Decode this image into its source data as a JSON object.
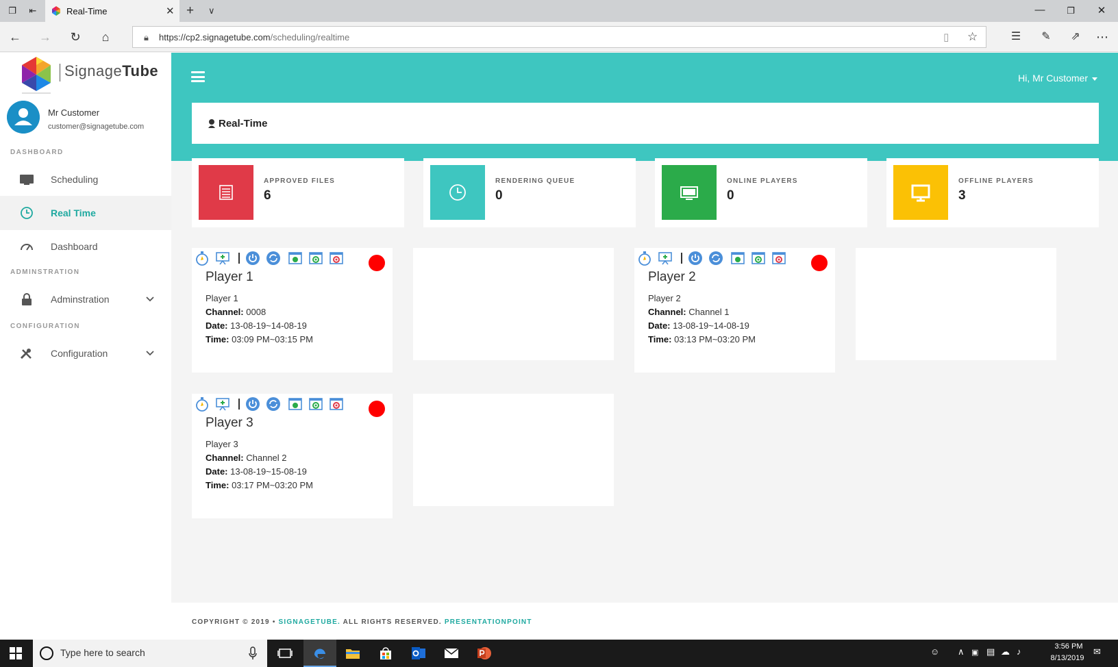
{
  "browser": {
    "tab_title": "Real-Time",
    "url_host": "https://cp2.signagetube.com",
    "url_path": "/scheduling/realtime"
  },
  "brand": {
    "light": "Signage",
    "bold": "Tube"
  },
  "user": {
    "name": "Mr Customer",
    "email": "customer@signagetube.com",
    "greeting": "Hi, Mr Customer"
  },
  "sidebar": {
    "sections": [
      "DASHBOARD",
      "ADMINSTRATION",
      "CONFIGURATION"
    ],
    "items": [
      {
        "label": "Scheduling",
        "icon": "monitor-icon"
      },
      {
        "label": "Real Time",
        "icon": "clock-icon",
        "active": true
      },
      {
        "label": "Dashboard",
        "icon": "gauge-icon"
      },
      {
        "label": "Adminstration",
        "icon": "lock-icon"
      },
      {
        "label": "Configuration",
        "icon": "tools-icon"
      }
    ]
  },
  "page": {
    "title": "Real-Time"
  },
  "stats": [
    {
      "label": "APPROVED FILES",
      "value": "6",
      "color": "#e03a48",
      "icon": "list-icon"
    },
    {
      "label": "RENDERING QUEUE",
      "value": "0",
      "color": "#3ec6c0",
      "icon": "clock-icon"
    },
    {
      "label": "ONLINE PLAYERS",
      "value": "0",
      "color": "#2bab4a",
      "icon": "monitor-icon"
    },
    {
      "label": "OFFLINE PLAYERS",
      "value": "3",
      "color": "#fbc105",
      "icon": "display-icon"
    }
  ],
  "players": [
    {
      "title": "Player 1",
      "name": "Player 1",
      "channel_label": "Channel:",
      "channel": "0008",
      "date_label": "Date:",
      "date": "13-08-19~14-08-19",
      "time_label": "Time:",
      "time": "03:09 PM~03:15 PM",
      "status_color": "#ff0000"
    },
    {
      "title": "Player 2",
      "name": "Player 2",
      "channel_label": "Channel:",
      "channel": "Channel 1",
      "date_label": "Date:",
      "date": "13-08-19~14-08-19",
      "time_label": "Time:",
      "time": "03:13 PM~03:20 PM",
      "status_color": "#ff0000"
    },
    {
      "title": "Player 3",
      "name": "Player 3",
      "channel_label": "Channel:",
      "channel": "Channel 2",
      "date_label": "Date:",
      "date": "13-08-19~15-08-19",
      "time_label": "Time:",
      "time": "03:17 PM~03:20 PM",
      "status_color": "#ff0000"
    }
  ],
  "footer": {
    "copyright": "COPYRIGHT © 2019",
    "bullet": "•",
    "brand": "SIGNAGETUBE.",
    "rights": "ALL RIGHTS RESERVED.",
    "link": "PRESENTATIONPOINT"
  },
  "taskbar": {
    "search_placeholder": "Type here to search",
    "time": "3:56 PM",
    "date": "8/13/2019"
  },
  "colors": {
    "teal": "#3ec6c0",
    "accent": "#1fa9a0",
    "status_offline": "#ff0000"
  }
}
